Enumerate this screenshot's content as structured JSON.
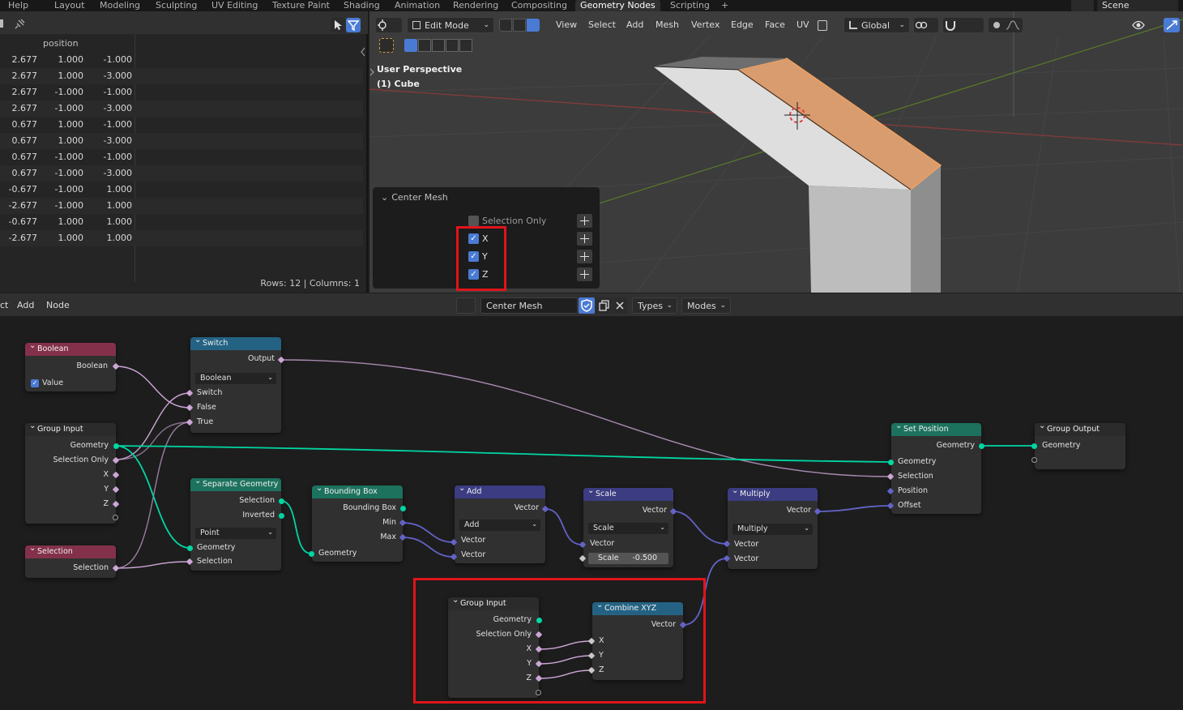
{
  "topbar": {
    "help": "Help",
    "tabs": [
      "Layout",
      "Modeling",
      "Sculpting",
      "UV Editing",
      "Texture Paint",
      "Shading",
      "Animation",
      "Rendering",
      "Compositing",
      "Geometry Nodes",
      "Scripting"
    ],
    "active_tab": "Geometry Nodes",
    "add_tab": "+",
    "scene": "Scene"
  },
  "spreadsheet": {
    "column": "position",
    "rows": [
      [
        "2.677",
        "1.000",
        "-1.000"
      ],
      [
        "2.677",
        "1.000",
        "-3.000"
      ],
      [
        "2.677",
        "-1.000",
        "-1.000"
      ],
      [
        "2.677",
        "-1.000",
        "-3.000"
      ],
      [
        "0.677",
        "1.000",
        "-1.000"
      ],
      [
        "0.677",
        "1.000",
        "-3.000"
      ],
      [
        "0.677",
        "-1.000",
        "-1.000"
      ],
      [
        "0.677",
        "-1.000",
        "-3.000"
      ],
      [
        "-0.677",
        "-1.000",
        "1.000"
      ],
      [
        "-2.677",
        "-1.000",
        "1.000"
      ],
      [
        "-0.677",
        "1.000",
        "1.000"
      ],
      [
        "-2.677",
        "1.000",
        "1.000"
      ]
    ],
    "footer": "Rows: 12   |   Columns: 1"
  },
  "viewport": {
    "mode": "Edit Mode",
    "menus": [
      "View",
      "Select",
      "Add",
      "Mesh",
      "Vertex",
      "Edge",
      "Face",
      "UV"
    ],
    "transform": "Global",
    "info_line1": "User Perspective",
    "info_line2": "(1) Cube"
  },
  "operator": {
    "title": "Center Mesh",
    "options": [
      {
        "label": "Selection Only",
        "checked": false
      },
      {
        "label": "X",
        "checked": true
      },
      {
        "label": "Y",
        "checked": true
      },
      {
        "label": "Z",
        "checked": true
      }
    ]
  },
  "node_editor": {
    "menus": [
      "Select",
      "Add",
      "Node"
    ],
    "menu_cut": "ct",
    "group_name": "Center Mesh",
    "types": "Types",
    "modes": "Modes"
  },
  "nodes": {
    "boolean": {
      "title": "Boolean",
      "out": "Boolean",
      "value": "Value"
    },
    "switch": {
      "title": "Switch",
      "out": "Output",
      "type": "Boolean",
      "in": [
        "Switch",
        "False",
        "True"
      ]
    },
    "group_input": {
      "title": "Group Input",
      "out": [
        "Geometry",
        "Selection Only",
        "X",
        "Y",
        "Z"
      ]
    },
    "selection": {
      "title": "Selection",
      "out": "Selection"
    },
    "separate": {
      "title": "Separate Geometry",
      "out": [
        "Selection",
        "Inverted"
      ],
      "domain": "Point",
      "in": [
        "Geometry",
        "Selection"
      ]
    },
    "bbox": {
      "title": "Bounding Box",
      "out": [
        "Bounding Box",
        "Min",
        "Max"
      ],
      "in": "Geometry"
    },
    "add": {
      "title": "Add",
      "out": "Vector",
      "op": "Add",
      "in": [
        "Vector",
        "Vector"
      ]
    },
    "scale": {
      "title": "Scale",
      "out": "Vector",
      "op": "Scale",
      "in": "Vector",
      "field_label": "Scale",
      "field_value": "-0.500"
    },
    "multiply": {
      "title": "Multiply",
      "out": "Vector",
      "op": "Multiply",
      "in": [
        "Vector",
        "Vector"
      ]
    },
    "set_position": {
      "title": "Set Position",
      "out": "Geometry",
      "in": [
        "Geometry",
        "Selection",
        "Position",
        "Offset"
      ]
    },
    "group_output": {
      "title": "Group Output",
      "in": "Geometry"
    },
    "group_input2": {
      "title": "Group Input",
      "out": [
        "Geometry",
        "Selection Only",
        "X",
        "Y",
        "Z"
      ]
    },
    "combine": {
      "title": "Combine XYZ",
      "out": "Vector",
      "in": [
        "X",
        "Y",
        "Z"
      ]
    }
  },
  "colors": {
    "highlight": "#e0141b",
    "geometry_socket": "#00d6a3",
    "boolean_socket": "#cca6d6",
    "vector_socket": "#6363c7",
    "checkbox": "#4a7bd4",
    "selected_face": "#d89a6a"
  }
}
